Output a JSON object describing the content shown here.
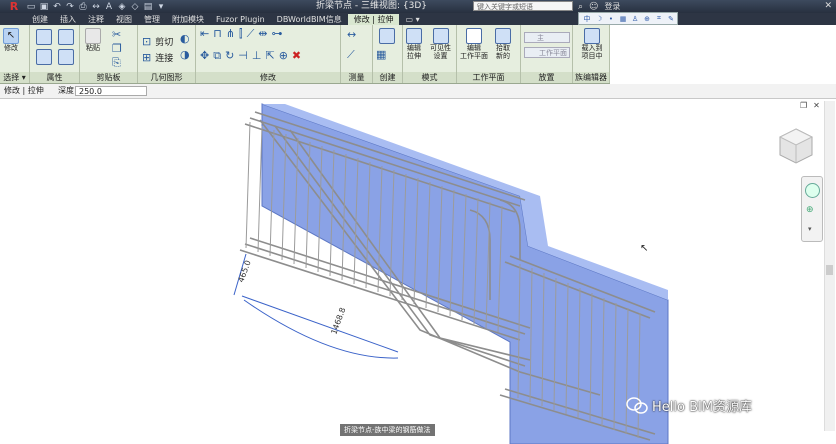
{
  "title_bar": {
    "app_logo": "R",
    "document_title": "折梁节点 - 三维视图: {3D}",
    "search_placeholder": "键入关键字或短语",
    "user_label": "登录",
    "close_glyph": "✕"
  },
  "tabs": [
    {
      "label": "创建"
    },
    {
      "label": "插入"
    },
    {
      "label": "注释"
    },
    {
      "label": "视图"
    },
    {
      "label": "管理"
    },
    {
      "label": "附加模块"
    },
    {
      "label": "Fuzor Plugin"
    },
    {
      "label": "DBWorldBIM信息"
    },
    {
      "label": "修改 | 拉伸"
    }
  ],
  "ribbon": {
    "modify_label": "修改",
    "cut_label": "剪切",
    "join_label": "连接",
    "paste_label": "粘贴",
    "edit_extrusion_label": "编辑\n拉伸",
    "visibility_label": "可见性\n设置",
    "edit_workplane_label": "编辑\n工作平面",
    "pick_new_label": "拾取\n新的",
    "host_label": "主",
    "workplane_btn_label": "工作平面",
    "load_project_label": "载入到\n项目中",
    "panels": {
      "select": "选择 ▾",
      "properties": "属性",
      "clipboard": "剪贴板",
      "geometry": "几何图形",
      "modify": "修改",
      "measure": "测量",
      "create": "创建",
      "mode": "模式",
      "workplane": "工作平面",
      "place": "放置",
      "family_editor": "族编辑器"
    }
  },
  "options_bar": {
    "mode": "修改 | 拉伸",
    "depth_label": "深度",
    "depth_value": "250.0"
  },
  "viewport": {
    "dim_short": "465.0",
    "dim_long": "1468.8",
    "subtitle": "折梁节点-族中梁的钢筋做法",
    "watermark": "Hello BIM资源库"
  },
  "colors": {
    "ribbon_bg": "#e6eedf",
    "wall_blue": "#7f9be0",
    "rebar": "#9a9a9a"
  }
}
